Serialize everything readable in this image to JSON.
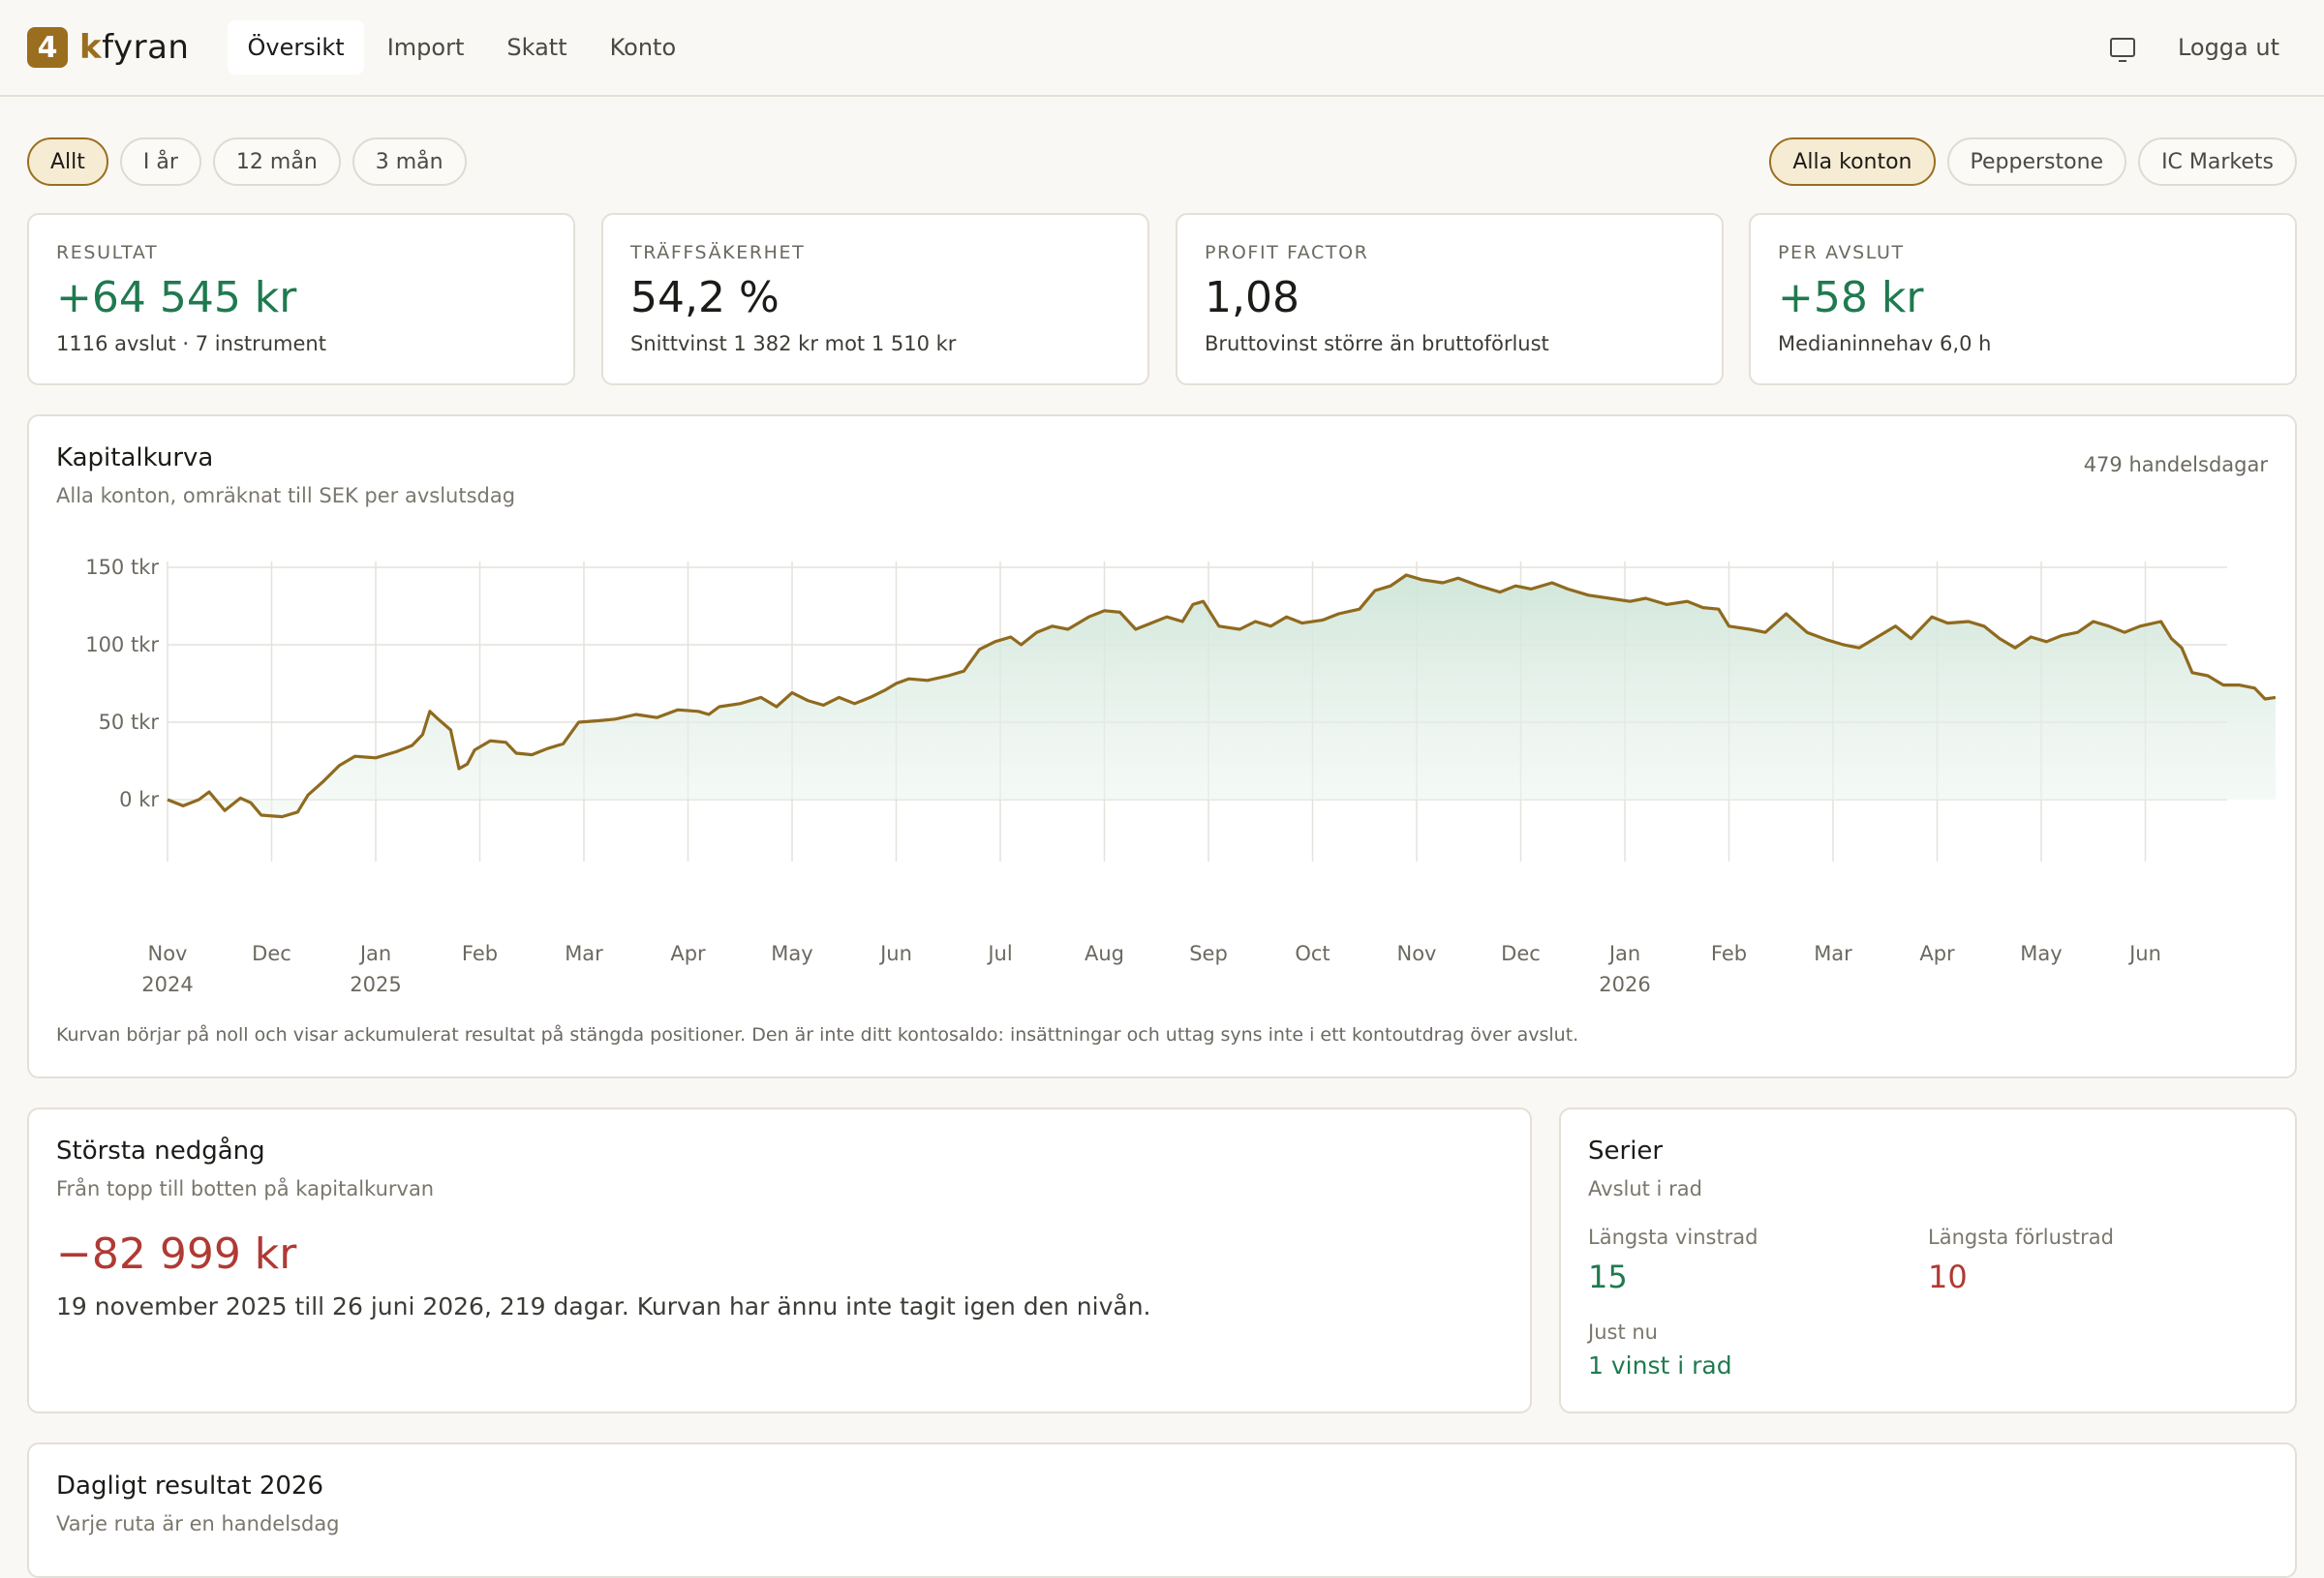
{
  "brand": {
    "badge": "4",
    "name_accent": "k",
    "name_rest": "fyran"
  },
  "nav": {
    "items": [
      {
        "label": "Översikt",
        "active": true
      },
      {
        "label": "Import",
        "active": false
      },
      {
        "label": "Skatt",
        "active": false
      },
      {
        "label": "Konto",
        "active": false
      }
    ]
  },
  "header": {
    "screen_icon": "monitor-icon",
    "logout": "Logga ut"
  },
  "filters": {
    "periods": [
      {
        "label": "Allt",
        "active": true
      },
      {
        "label": "I år",
        "active": false
      },
      {
        "label": "12 mån",
        "active": false
      },
      {
        "label": "3 mån",
        "active": false
      }
    ],
    "accounts": [
      {
        "label": "Alla konton",
        "active": true
      },
      {
        "label": "Pepperstone",
        "active": false
      },
      {
        "label": "IC Markets",
        "active": false
      }
    ]
  },
  "stats": [
    {
      "label": "RESULTAT",
      "value": "+64 545 kr",
      "sub": "1116 avslut · 7 instrument",
      "positive": true
    },
    {
      "label": "TRÄFFSÄKERHET",
      "value": "54,2 %",
      "sub": "Snittvinst 1 382 kr mot 1 510 kr",
      "positive": false
    },
    {
      "label": "PROFIT FACTOR",
      "value": "1,08",
      "sub": "Bruttovinst större än bruttoförlust",
      "positive": false
    },
    {
      "label": "PER AVSLUT",
      "value": "+58 kr",
      "sub": "Medianinnehav 6,0 h",
      "positive": true
    }
  ],
  "equity": {
    "title": "Kapitalkurva",
    "subtitle": "Alla konton, omräknat till SEK per avslutsdag",
    "badge": "479 handelsdagar",
    "note": "Kurvan börjar på noll och visar ackumulerat resultat på stängda positioner. Den är inte ditt kontosaldo: insättningar och uttag syns inte i ett kontoutdrag över avslut."
  },
  "chart_data": {
    "type": "area",
    "x_unit": "month",
    "ylim": [
      -15000,
      160000
    ],
    "y_ticks": [
      {
        "value": 0,
        "label": "0 kr"
      },
      {
        "value": 50000,
        "label": "50 tkr"
      },
      {
        "value": 100000,
        "label": "100 tkr"
      },
      {
        "value": 150000,
        "label": "150 tkr"
      }
    ],
    "x_ticks": [
      {
        "m": 0,
        "label": "Nov",
        "year": "2024"
      },
      {
        "m": 1,
        "label": "Dec",
        "year": ""
      },
      {
        "m": 2,
        "label": "Jan",
        "year": "2025"
      },
      {
        "m": 3,
        "label": "Feb",
        "year": ""
      },
      {
        "m": 4,
        "label": "Mar",
        "year": ""
      },
      {
        "m": 5,
        "label": "Apr",
        "year": ""
      },
      {
        "m": 6,
        "label": "May",
        "year": ""
      },
      {
        "m": 7,
        "label": "Jun",
        "year": ""
      },
      {
        "m": 8,
        "label": "Jul",
        "year": ""
      },
      {
        "m": 9,
        "label": "Aug",
        "year": ""
      },
      {
        "m": 10,
        "label": "Sep",
        "year": ""
      },
      {
        "m": 11,
        "label": "Oct",
        "year": ""
      },
      {
        "m": 12,
        "label": "Nov",
        "year": ""
      },
      {
        "m": 13,
        "label": "Dec",
        "year": ""
      },
      {
        "m": 14,
        "label": "Jan",
        "year": "2026"
      },
      {
        "m": 15,
        "label": "Feb",
        "year": ""
      },
      {
        "m": 16,
        "label": "Mar",
        "year": ""
      },
      {
        "m": 17,
        "label": "Apr",
        "year": ""
      },
      {
        "m": 18,
        "label": "May",
        "year": ""
      },
      {
        "m": 19,
        "label": "Jun",
        "year": ""
      }
    ],
    "series": [
      {
        "points": [
          [
            0,
            0
          ],
          [
            0.15,
            -4000
          ],
          [
            0.3,
            0
          ],
          [
            0.4,
            5000
          ],
          [
            0.55,
            -7000
          ],
          [
            0.7,
            1000
          ],
          [
            0.8,
            -2000
          ],
          [
            0.9,
            -10000
          ],
          [
            1.1,
            -11000
          ],
          [
            1.25,
            -8000
          ],
          [
            1.35,
            3000
          ],
          [
            1.5,
            12000
          ],
          [
            1.65,
            22000
          ],
          [
            1.8,
            28000
          ],
          [
            2.0,
            27000
          ],
          [
            2.2,
            31000
          ],
          [
            2.35,
            35000
          ],
          [
            2.45,
            42000
          ],
          [
            2.52,
            57000
          ],
          [
            2.6,
            52000
          ],
          [
            2.72,
            45000
          ],
          [
            2.8,
            20000
          ],
          [
            2.88,
            23000
          ],
          [
            2.95,
            32000
          ],
          [
            3.1,
            38000
          ],
          [
            3.25,
            37000
          ],
          [
            3.35,
            30000
          ],
          [
            3.5,
            29000
          ],
          [
            3.65,
            33000
          ],
          [
            3.8,
            36000
          ],
          [
            3.95,
            50000
          ],
          [
            4.15,
            51000
          ],
          [
            4.3,
            52000
          ],
          [
            4.5,
            55000
          ],
          [
            4.7,
            53000
          ],
          [
            4.9,
            58000
          ],
          [
            5.1,
            57000
          ],
          [
            5.2,
            55000
          ],
          [
            5.3,
            60000
          ],
          [
            5.5,
            62000
          ],
          [
            5.7,
            66000
          ],
          [
            5.85,
            60000
          ],
          [
            6.0,
            69000
          ],
          [
            6.15,
            64000
          ],
          [
            6.3,
            61000
          ],
          [
            6.45,
            66000
          ],
          [
            6.6,
            62000
          ],
          [
            6.75,
            66000
          ],
          [
            6.9,
            71000
          ],
          [
            7.0,
            75000
          ],
          [
            7.12,
            78000
          ],
          [
            7.3,
            77000
          ],
          [
            7.5,
            80000
          ],
          [
            7.65,
            83000
          ],
          [
            7.8,
            97000
          ],
          [
            7.95,
            102000
          ],
          [
            8.1,
            105000
          ],
          [
            8.2,
            100000
          ],
          [
            8.35,
            108000
          ],
          [
            8.5,
            112000
          ],
          [
            8.65,
            110000
          ],
          [
            8.85,
            118000
          ],
          [
            9.0,
            122000
          ],
          [
            9.15,
            121000
          ],
          [
            9.3,
            110000
          ],
          [
            9.45,
            114000
          ],
          [
            9.6,
            118000
          ],
          [
            9.75,
            115000
          ],
          [
            9.85,
            126000
          ],
          [
            9.95,
            128000
          ],
          [
            10.1,
            112000
          ],
          [
            10.3,
            110000
          ],
          [
            10.45,
            115000
          ],
          [
            10.6,
            112000
          ],
          [
            10.75,
            118000
          ],
          [
            10.9,
            114000
          ],
          [
            11.1,
            116000
          ],
          [
            11.25,
            120000
          ],
          [
            11.45,
            123000
          ],
          [
            11.6,
            135000
          ],
          [
            11.75,
            138000
          ],
          [
            11.9,
            145000
          ],
          [
            12.05,
            142000
          ],
          [
            12.25,
            140000
          ],
          [
            12.4,
            143000
          ],
          [
            12.6,
            138000
          ],
          [
            12.8,
            134000
          ],
          [
            12.95,
            138000
          ],
          [
            13.1,
            136000
          ],
          [
            13.3,
            140000
          ],
          [
            13.45,
            136000
          ],
          [
            13.65,
            132000
          ],
          [
            13.85,
            130000
          ],
          [
            14.05,
            128000
          ],
          [
            14.2,
            130000
          ],
          [
            14.4,
            126000
          ],
          [
            14.6,
            128000
          ],
          [
            14.75,
            124000
          ],
          [
            14.9,
            123000
          ],
          [
            15.0,
            112000
          ],
          [
            15.2,
            110000
          ],
          [
            15.35,
            108000
          ],
          [
            15.55,
            120000
          ],
          [
            15.75,
            108000
          ],
          [
            15.95,
            103000
          ],
          [
            16.1,
            100000
          ],
          [
            16.25,
            98000
          ],
          [
            16.45,
            106000
          ],
          [
            16.6,
            112000
          ],
          [
            16.75,
            104000
          ],
          [
            16.95,
            118000
          ],
          [
            17.1,
            114000
          ],
          [
            17.3,
            115000
          ],
          [
            17.45,
            112000
          ],
          [
            17.6,
            104000
          ],
          [
            17.75,
            98000
          ],
          [
            17.9,
            105000
          ],
          [
            18.05,
            102000
          ],
          [
            18.2,
            106000
          ],
          [
            18.35,
            108000
          ],
          [
            18.5,
            115000
          ],
          [
            18.65,
            112000
          ],
          [
            18.8,
            108000
          ],
          [
            18.95,
            112000
          ],
          [
            19.15,
            115000
          ],
          [
            19.25,
            104000
          ],
          [
            19.35,
            98000
          ],
          [
            19.45,
            82000
          ],
          [
            19.6,
            80000
          ],
          [
            19.75,
            74000
          ],
          [
            19.9,
            74000
          ],
          [
            20.05,
            72000
          ],
          [
            20.15,
            65000
          ],
          [
            20.25,
            66000
          ]
        ]
      }
    ]
  },
  "drawdown": {
    "title": "Största nedgång",
    "subtitle": "Från topp till botten på kapitalkurvan",
    "value": "−82 999 kr",
    "text": "19 november 2025 till 26 juni 2026, 219 dagar. Kurvan har ännu inte tagit igen den nivån."
  },
  "series_card": {
    "title": "Serier",
    "subtitle": "Avslut i rad",
    "win_label": "Längsta vinstrad",
    "win_value": "15",
    "loss_label": "Längsta förlustrad",
    "loss_value": "10",
    "now_label": "Just nu",
    "now_value": "1 vinst i rad"
  },
  "daily": {
    "title": "Dagligt resultat 2026",
    "subtitle": "Varje ruta är en handelsdag"
  },
  "colors": {
    "accent": "#9a6e1f",
    "positive": "#1f7a4f",
    "negative": "#b03a34",
    "fill": "#d9ebe1"
  }
}
